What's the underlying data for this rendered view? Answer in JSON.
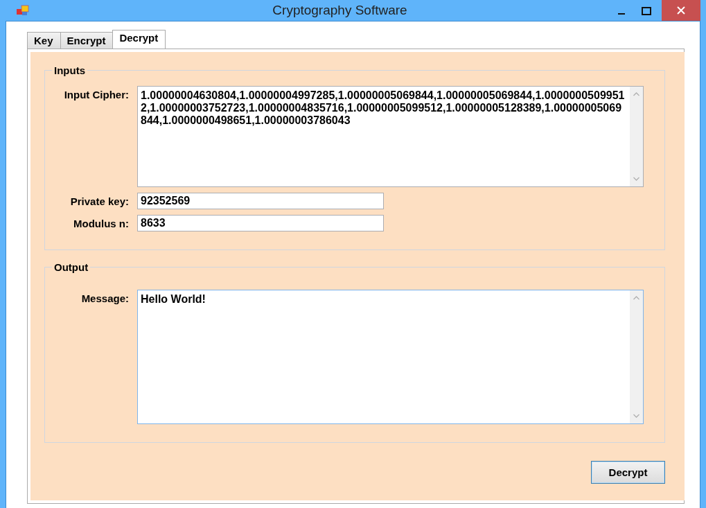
{
  "window": {
    "title": "Cryptography Software"
  },
  "tabs": [
    {
      "label": "Key",
      "selected": false
    },
    {
      "label": "Encrypt",
      "selected": false
    },
    {
      "label": "Decrypt",
      "selected": true
    }
  ],
  "inputs": {
    "title": "Inputs",
    "fields": [
      {
        "kind": "multiline",
        "label": "Input Cipher:",
        "value": "1.00000004630804,1.00000004997285,1.00000005069844,1.00000005069844,1.00000005099512,1.00000003752723,1.00000004835716,1.00000005099512,1.00000005128389,1.00000005069844,1.0000000498651,1.00000003786043"
      },
      {
        "kind": "line",
        "label": "Private key:",
        "value": "92352569"
      },
      {
        "kind": "line",
        "label": "Modulus n:",
        "value": "8633"
      }
    ]
  },
  "output": {
    "title": "Output",
    "fields": [
      {
        "kind": "multiline",
        "label": "Message:",
        "value": "Hello World!"
      }
    ]
  },
  "button": "Decrypt"
}
